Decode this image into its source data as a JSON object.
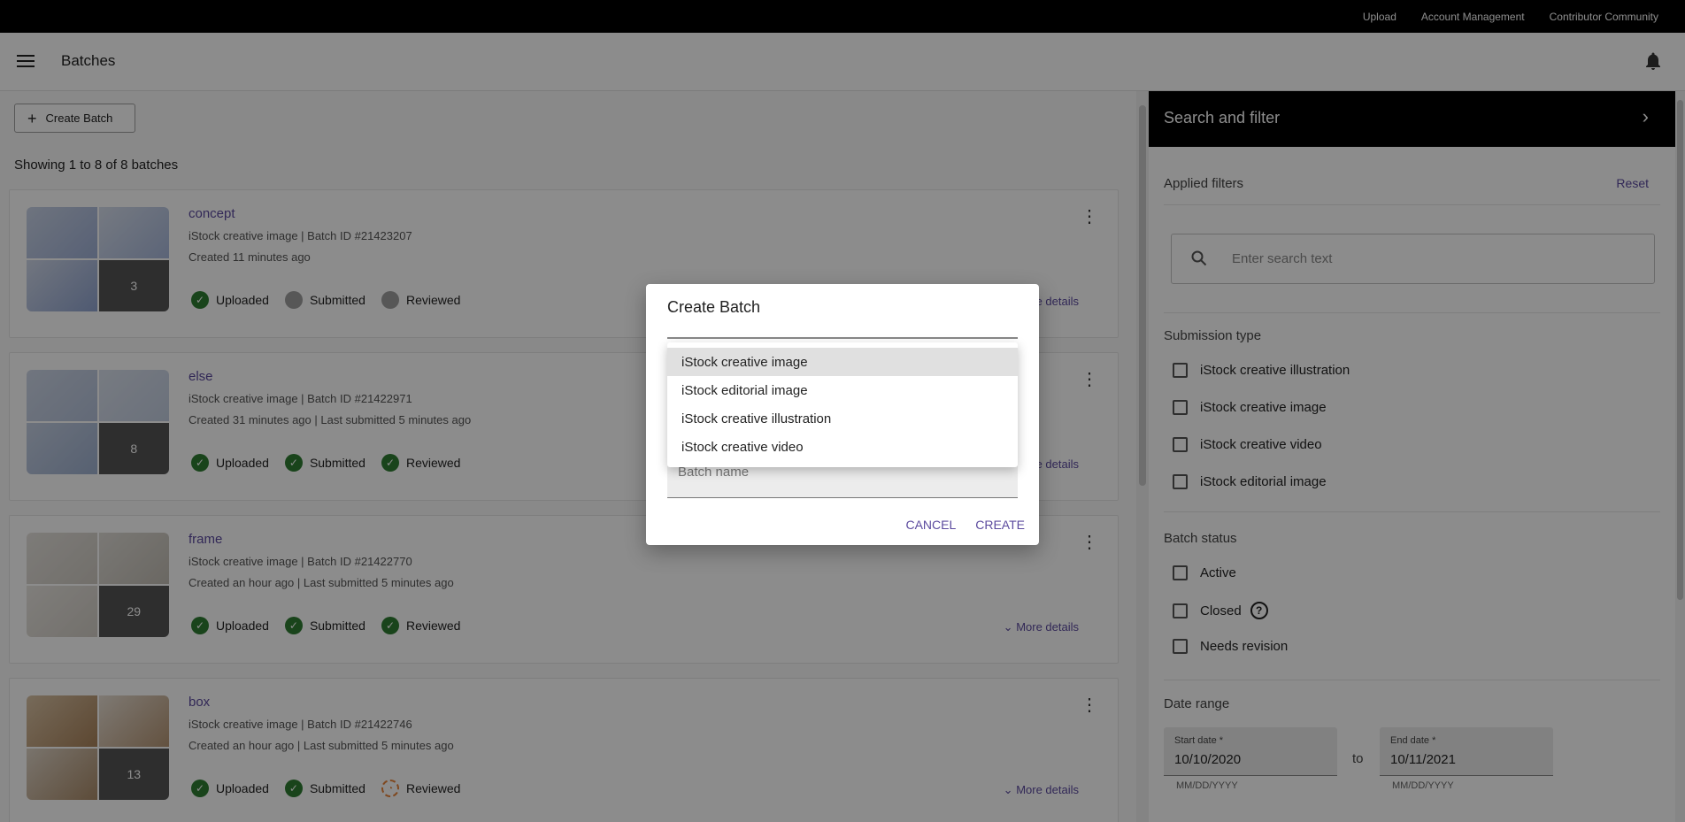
{
  "topbar": {
    "links": [
      "Upload",
      "Account Management",
      "Contributor Community"
    ]
  },
  "appbar": {
    "title": "Batches"
  },
  "main": {
    "create_label": "Create Batch",
    "showing": "Showing 1 to 8 of 8 batches",
    "batches": [
      {
        "name": "concept",
        "meta": "iStock creative image | Batch ID #21423207",
        "created": "Created 11 minutes ago",
        "count": "3",
        "statuses": [
          {
            "label": "Uploaded",
            "state": "done"
          },
          {
            "label": "Submitted",
            "state": "pending"
          },
          {
            "label": "Reviewed",
            "state": "pending"
          }
        ],
        "more": "More details"
      },
      {
        "name": "else",
        "meta": "iStock creative image | Batch ID #21422971",
        "created": "Created 31 minutes ago | Last submitted 5 minutes ago",
        "count": "8",
        "statuses": [
          {
            "label": "Uploaded",
            "state": "done"
          },
          {
            "label": "Submitted",
            "state": "done"
          },
          {
            "label": "Reviewed",
            "state": "done"
          }
        ],
        "more": "More details"
      },
      {
        "name": "frame",
        "meta": "iStock creative image | Batch ID #21422770",
        "created": "Created an hour ago | Last submitted 5 minutes ago",
        "count": "29",
        "statuses": [
          {
            "label": "Uploaded",
            "state": "done"
          },
          {
            "label": "Submitted",
            "state": "done"
          },
          {
            "label": "Reviewed",
            "state": "done"
          }
        ],
        "more": "More details"
      },
      {
        "name": "box",
        "meta": "iStock creative image | Batch ID #21422746",
        "created": "Created an hour ago | Last submitted 5 minutes ago",
        "count": "13",
        "statuses": [
          {
            "label": "Uploaded",
            "state": "done"
          },
          {
            "label": "Submitted",
            "state": "done"
          },
          {
            "label": "Reviewed",
            "state": "in-progress"
          }
        ],
        "more": "More details"
      }
    ]
  },
  "side": {
    "title": "Search and filter",
    "applied": "Applied filters",
    "reset": "Reset",
    "search_placeholder": "Enter search text",
    "submission_title": "Submission type",
    "submission_types": [
      "iStock creative illustration",
      "iStock creative image",
      "iStock creative video",
      "iStock editorial image"
    ],
    "status_title": "Batch status",
    "statuses": [
      "Active",
      "Closed",
      "Needs revision"
    ],
    "date_title": "Date range",
    "start_label": "Start date *",
    "start_value": "10/10/2020",
    "end_label": "End date *",
    "end_value": "10/11/2021",
    "date_hint": "MM/DD/YYYY",
    "to": "to"
  },
  "dialog": {
    "title": "Create Batch",
    "options": [
      "iStock creative image",
      "iStock editorial image",
      "iStock creative illustration",
      "iStock creative video"
    ],
    "selected_index": 0,
    "name_placeholder": "Batch name",
    "cancel": "CANCEL",
    "create": "CREATE"
  },
  "colors": {
    "accent": "#5b4a9e",
    "success": "#2e7d32",
    "progress": "#e8833a"
  }
}
